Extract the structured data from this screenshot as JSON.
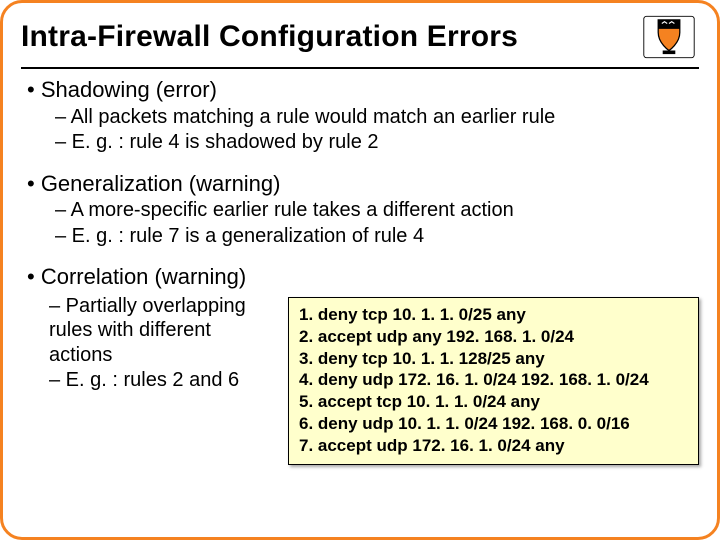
{
  "title": "Intra-Firewall Configuration Errors",
  "crest_name": "princeton-shield-icon",
  "sections": {
    "shadowing": {
      "heading": "• Shadowing (error)",
      "pt1": "– All packets matching a rule would match an earlier rule",
      "pt2": "– E. g. : rule 4 is shadowed by rule 2"
    },
    "generalization": {
      "heading": "• Generalization (warning)",
      "pt1": "– A more-specific earlier rule takes a different action",
      "pt2": "– E. g. : rule 7 is a generalization of rule 4"
    },
    "correlation": {
      "heading": "• Correlation (warning)",
      "pt1": "– Partially overlapping rules with different actions",
      "pt2": "– E. g. : rules 2 and 6"
    }
  },
  "rules": {
    "r1": "1. deny tcp 10. 1. 1. 0/25 any",
    "r2": "2. accept udp any 192. 168. 1. 0/24",
    "r3": "3. deny tcp 10. 1. 1. 128/25 any",
    "r4": "4. deny udp 172. 16. 1. 0/24 192. 168. 1. 0/24",
    "r5": "5. accept tcp 10. 1. 1. 0/24 any",
    "r6": "6. deny udp 10. 1. 1. 0/24 192. 168. 0. 0/16",
    "r7": "7. accept udp 172. 16. 1. 0/24 any"
  }
}
